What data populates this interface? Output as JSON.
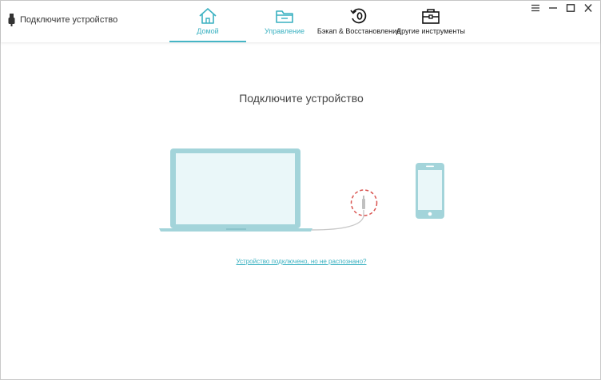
{
  "header": {
    "device_status": "Подключите устройство"
  },
  "tabs": [
    {
      "label": "Домой",
      "icon": "home-icon",
      "active": true
    },
    {
      "label": "Управление",
      "icon": "folder-icon",
      "active": false
    },
    {
      "label": "Бэкап & Восстановление",
      "icon": "backup-restore-icon",
      "active": false
    },
    {
      "label": "Другие инструменты",
      "icon": "toolbox-icon",
      "active": false
    }
  ],
  "window_controls": [
    "menu-icon",
    "minimize-icon",
    "maximize-icon",
    "close-icon"
  ],
  "main": {
    "title": "Подключите устройство",
    "help_link": "Устройство подключено, но не распознано?"
  },
  "colors": {
    "accent": "#3ab1c1",
    "device_frame": "#a3d4da",
    "device_screen": "#eaf7f9",
    "connector_ring": "#d9534f"
  }
}
